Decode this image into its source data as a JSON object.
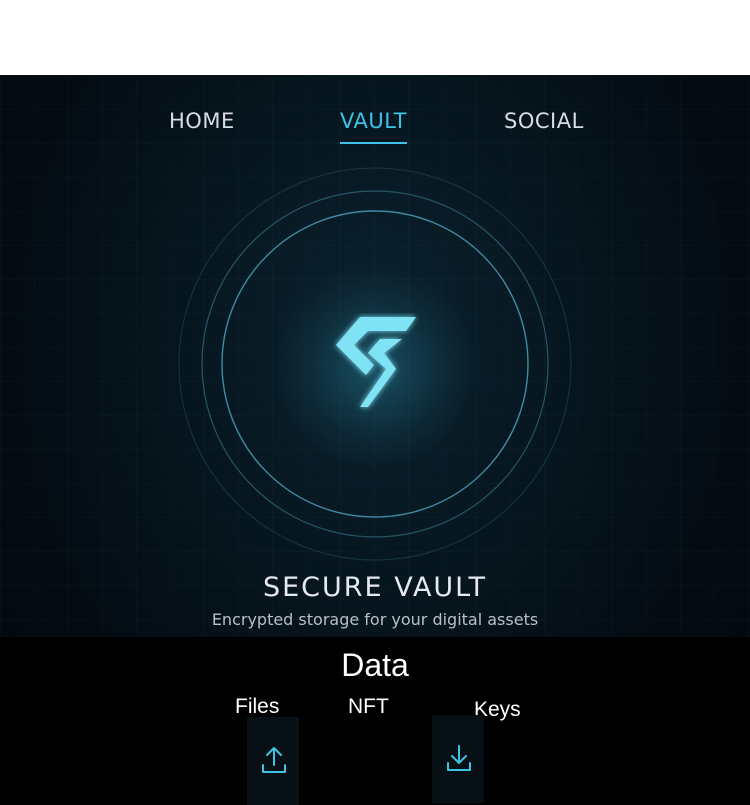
{
  "nav": {
    "tabs": [
      {
        "label": "HOME"
      },
      {
        "label": "VAULT"
      },
      {
        "label": "SOCIAL"
      }
    ],
    "active_tab": "VAULT"
  },
  "hero": {
    "logo_icon": "s-shield-logo-icon",
    "title": "SECURE VAULT",
    "subtitle": "Encrypted storage for your digital assets"
  },
  "data_section": {
    "title": "Data",
    "categories": [
      {
        "label": "Files"
      },
      {
        "label": "NFT"
      },
      {
        "label": "Keys"
      }
    ],
    "actions": [
      {
        "icon": "upload-icon"
      },
      {
        "icon": "download-icon"
      }
    ]
  },
  "colors": {
    "accent": "#3cc3e6",
    "background": "#040d13",
    "text": "#e6eaee"
  }
}
